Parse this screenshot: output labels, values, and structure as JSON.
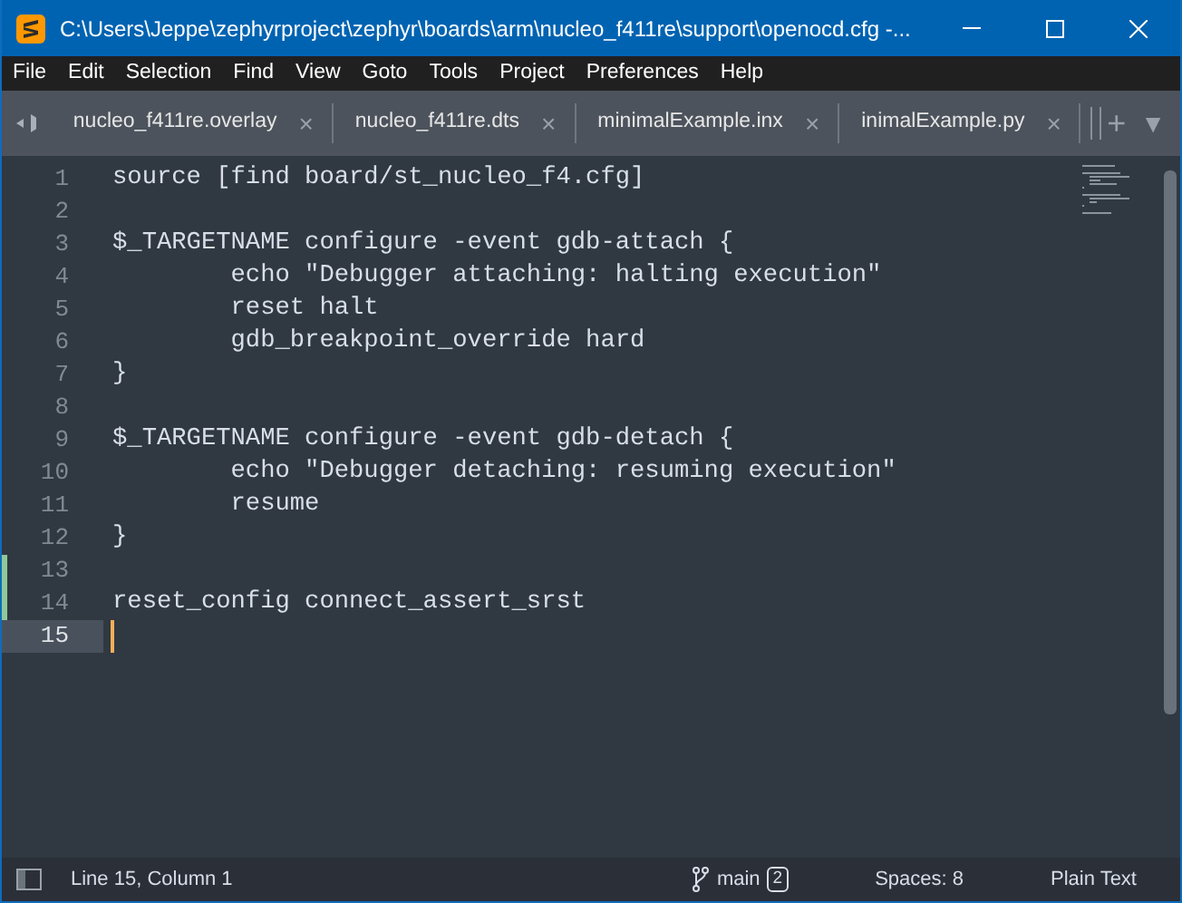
{
  "window": {
    "title": "C:\\Users\\Jeppe\\zephyrproject\\zephyr\\boards\\arm\\nucleo_f411re\\support\\openocd.cfg -..."
  },
  "menu": [
    "File",
    "Edit",
    "Selection",
    "Find",
    "View",
    "Goto",
    "Tools",
    "Project",
    "Preferences",
    "Help"
  ],
  "tabs": [
    {
      "label": "nucleo_f411re.overlay",
      "close": "×"
    },
    {
      "label": "nucleo_f411re.dts",
      "close": "×"
    },
    {
      "label": "minimalExample.inx",
      "close": "×"
    },
    {
      "label": "inimalExample.py",
      "close": "×"
    }
  ],
  "tab_actions": {
    "add": "+",
    "dropdown": "▼"
  },
  "lines": [
    {
      "number": "1",
      "text": "source [find board/st_nucleo_f4.cfg]",
      "changed": false,
      "current": false
    },
    {
      "number": "2",
      "changed": false,
      "current": false
    },
    {
      "number": "3",
      "text": "$_TARGETNAME configure -event gdb-attach {",
      "changed": false,
      "current": false
    },
    {
      "number": "4",
      "text": "        echo \"Debugger attaching: halting execution\"",
      "changed": false,
      "current": false
    },
    {
      "number": "5",
      "text": "        reset halt",
      "changed": false,
      "current": false
    },
    {
      "number": "6",
      "text": "        gdb_breakpoint_override hard",
      "changed": false,
      "current": false
    },
    {
      "number": "7",
      "text": "}",
      "changed": false,
      "current": false
    },
    {
      "number": "8",
      "changed": false,
      "current": false
    },
    {
      "number": "9",
      "text": "$_TARGETNAME configure -event gdb-detach {",
      "changed": false,
      "current": false
    },
    {
      "number": "10",
      "text": "        echo \"Debugger detaching: resuming execution\"",
      "changed": false,
      "current": false
    },
    {
      "number": "11",
      "text": "        resume",
      "changed": false,
      "current": false
    },
    {
      "number": "12",
      "text": "}",
      "changed": false,
      "current": false
    },
    {
      "number": "13",
      "changed": true,
      "current": false
    },
    {
      "number": "14",
      "text": "reset_config connect_assert_srst",
      "changed": true,
      "current": false
    },
    {
      "number": "15",
      "changed": false,
      "current": true
    }
  ],
  "status_bar": {
    "position": "Line 15, Column 1",
    "branch": "main",
    "branch_count": "2",
    "indent": "Spaces: 8",
    "syntax": "Plain Text"
  }
}
